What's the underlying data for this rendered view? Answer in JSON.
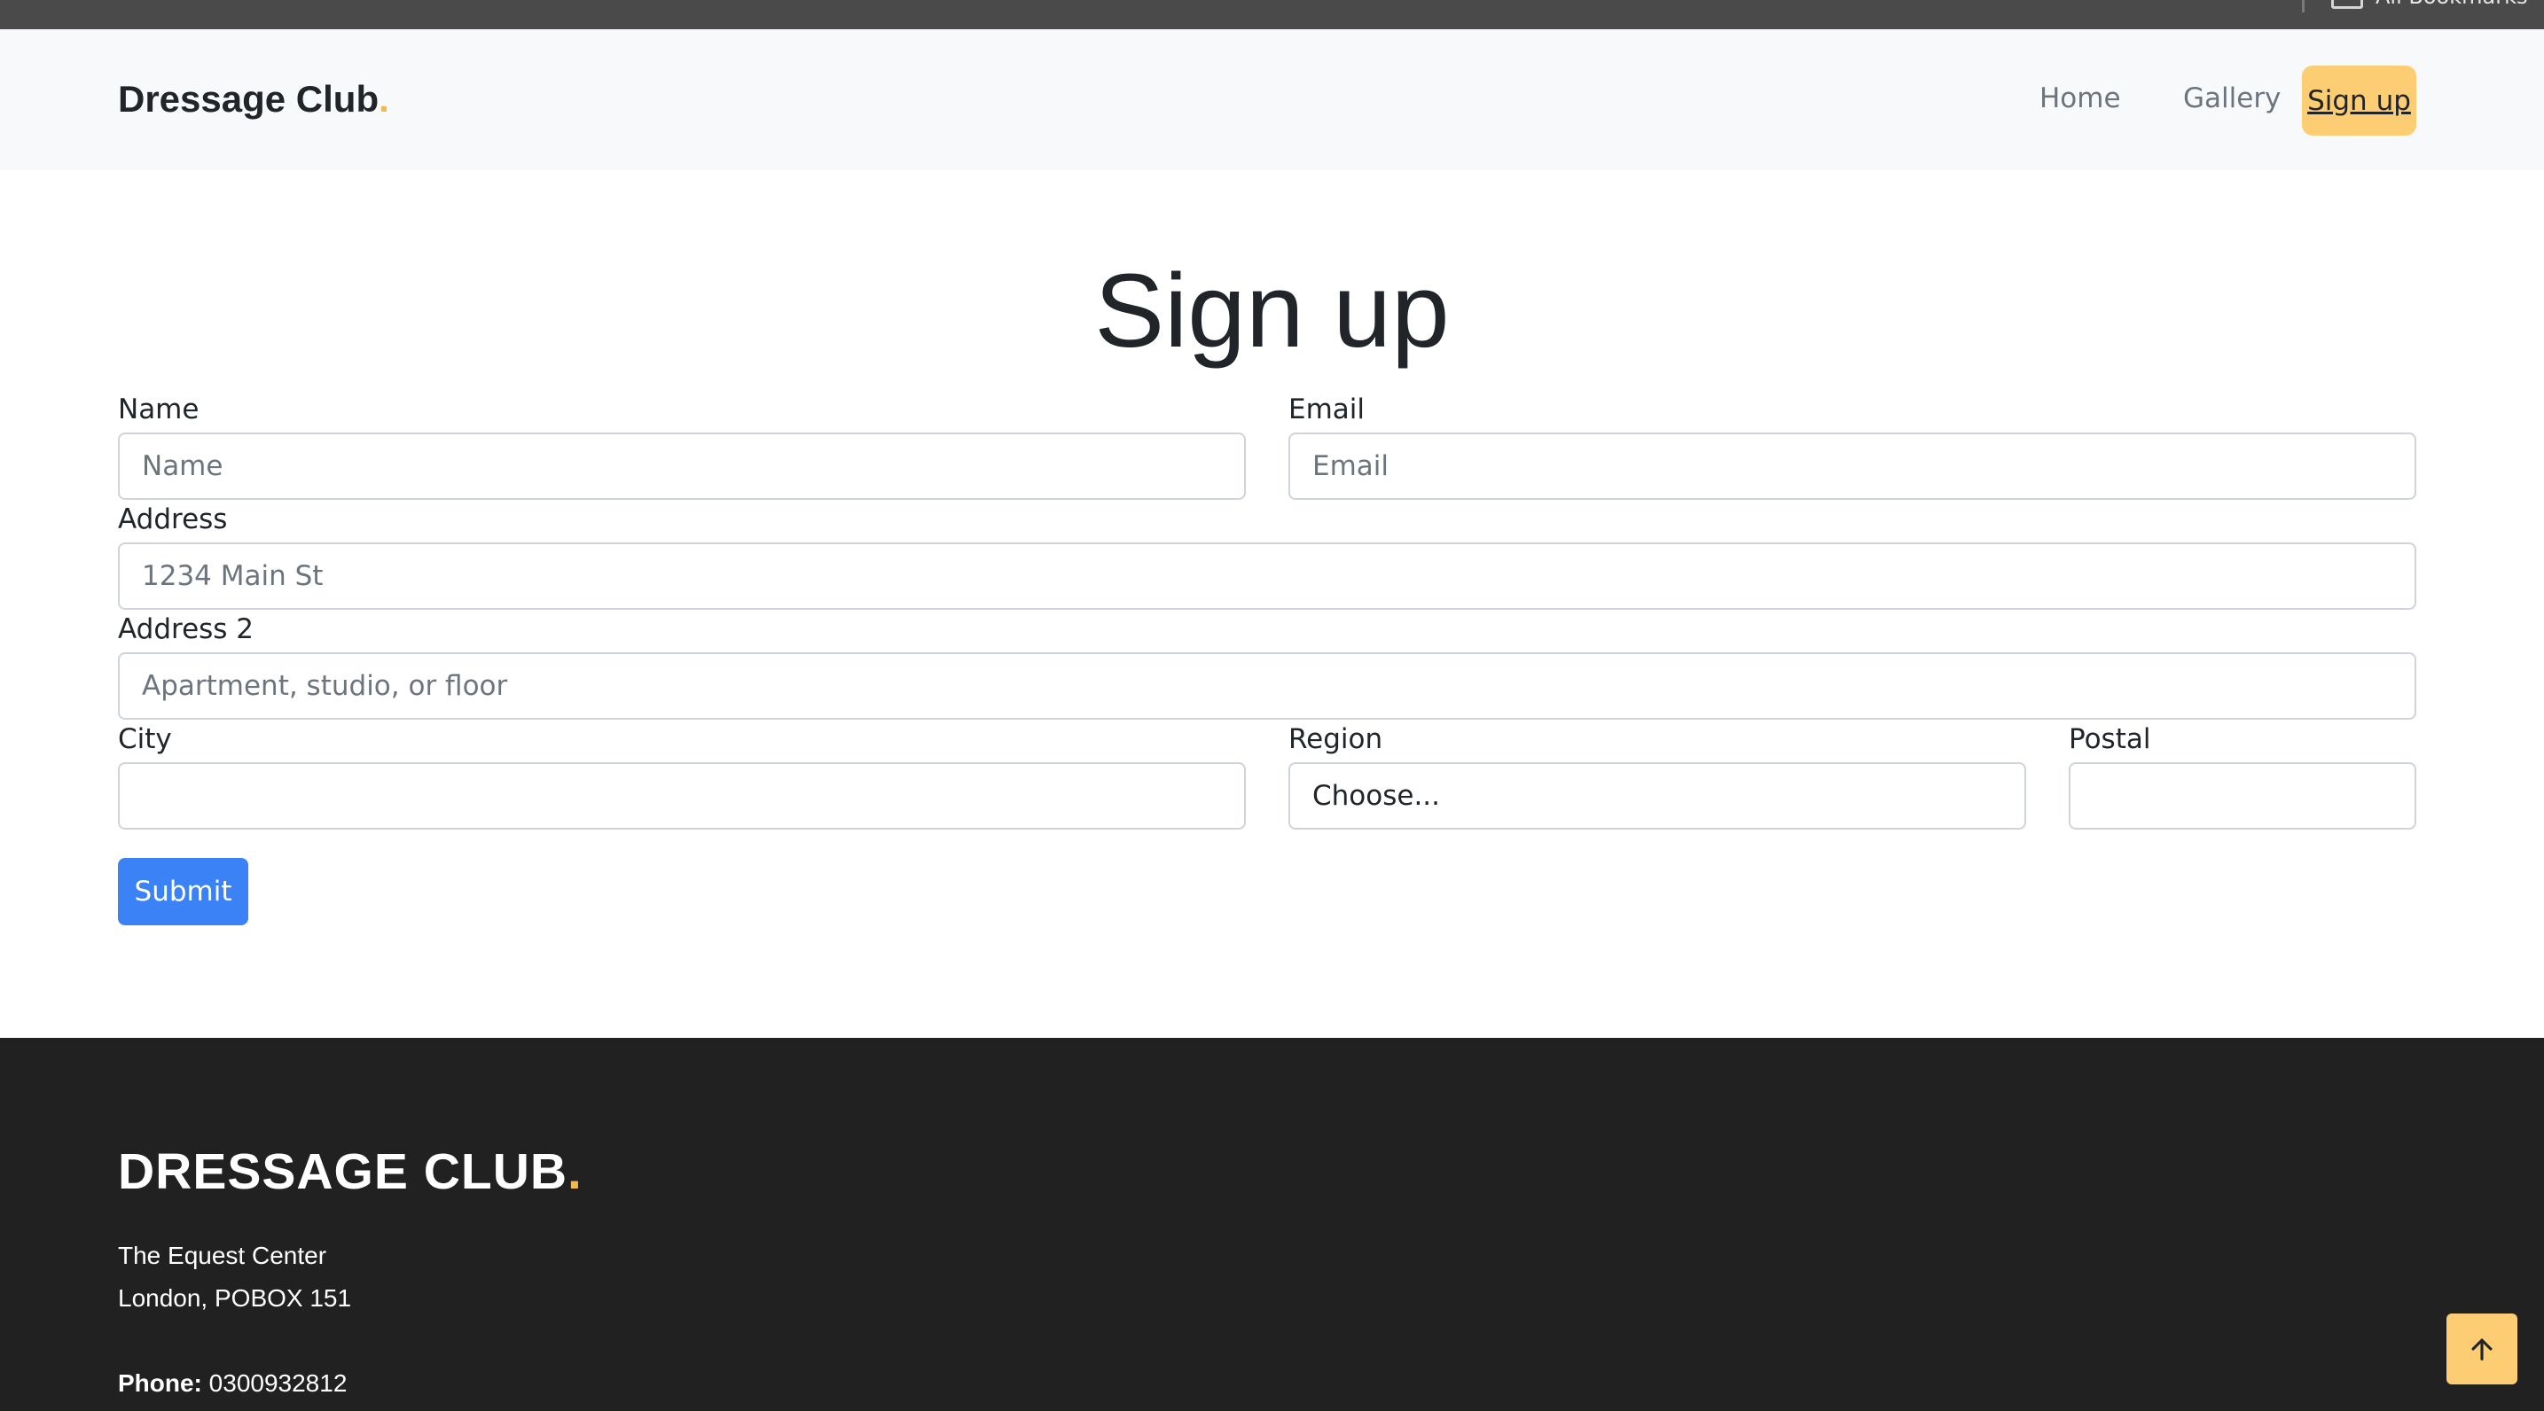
{
  "browser": {
    "bookmarks_label": "All Bookmarks"
  },
  "navbar": {
    "brand": "Dressage Club",
    "brand_dot": ".",
    "links": [
      {
        "label": "Home",
        "active": false
      },
      {
        "label": "Gallery",
        "active": false
      },
      {
        "label": "Sign up",
        "active": true
      }
    ]
  },
  "form": {
    "title": "Sign up",
    "fields": {
      "name": {
        "label": "Name",
        "placeholder": "Name"
      },
      "email": {
        "label": "Email",
        "placeholder": "Email"
      },
      "address": {
        "label": "Address",
        "placeholder": "1234 Main St"
      },
      "address2": {
        "label": "Address 2",
        "placeholder": "Apartment, studio, or floor"
      },
      "city": {
        "label": "City",
        "placeholder": ""
      },
      "region": {
        "label": "Region",
        "selected": "Choose..."
      },
      "postal": {
        "label": "Postal",
        "placeholder": ""
      }
    },
    "submit_label": "Submit"
  },
  "footer": {
    "brand": "DRESSAGE CLUB",
    "brand_dot": ".",
    "address_line1": "The Equest Center",
    "address_line2": "London, POBOX 151",
    "phone_label": "Phone:",
    "phone_value": "0300932812"
  },
  "colors": {
    "accent": "#fdcd73",
    "brand_dot": "#f3b94e",
    "primary_button": "#3b82f6",
    "footer_bg": "#212121",
    "navbar_bg": "#f8f9fa"
  },
  "icons": {
    "back_to_top": "arrow-up-icon",
    "bookmarks": "folder-icon"
  }
}
